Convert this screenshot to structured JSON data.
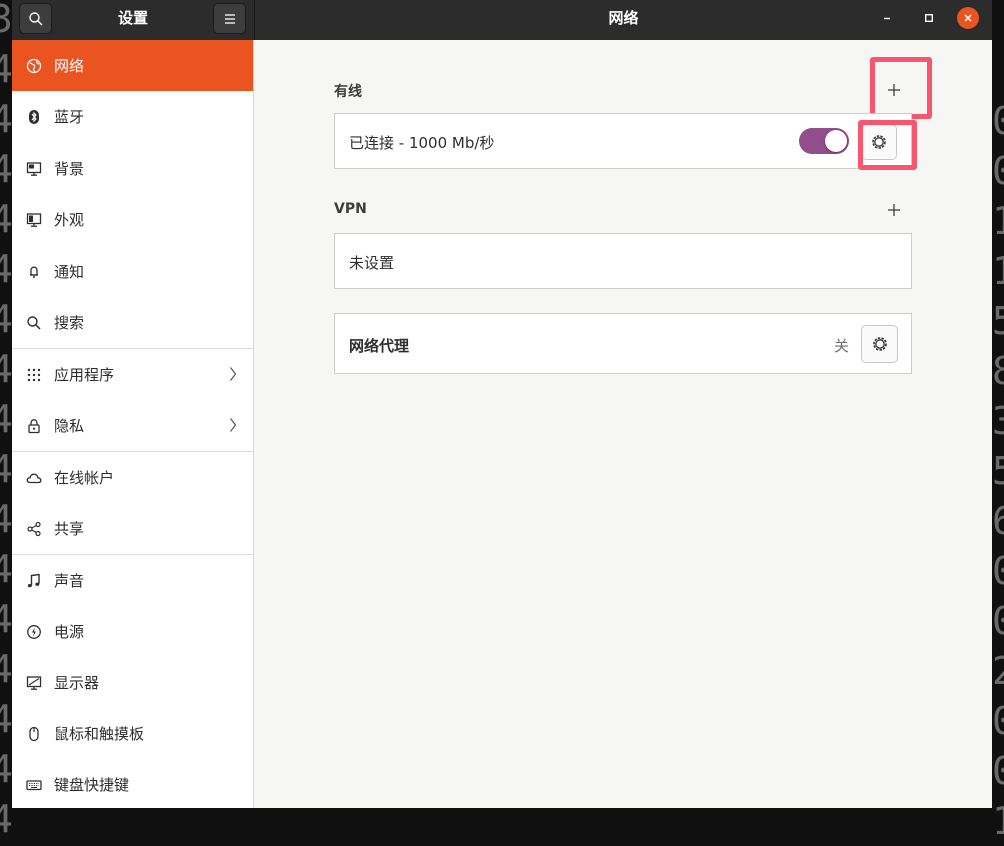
{
  "colors": {
    "accent": "#e95420",
    "toggle_on": "#924d8b",
    "highlight": "#f7566e"
  },
  "header": {
    "sidebar_title": "设置",
    "page_title": "网络"
  },
  "sidebar": {
    "items": [
      {
        "label": "网络",
        "icon": "network-icon",
        "active": true
      },
      {
        "label": "蓝牙",
        "icon": "bluetooth-icon"
      },
      {
        "label": "背景",
        "icon": "background-icon"
      },
      {
        "label": "外观",
        "icon": "appearance-icon"
      },
      {
        "label": "通知",
        "icon": "bell-icon"
      },
      {
        "label": "搜索",
        "icon": "search-icon"
      },
      {
        "label": "应用程序",
        "icon": "apps-grid-icon",
        "has_submenu": true
      },
      {
        "label": "隐私",
        "icon": "lock-icon",
        "has_submenu": true
      },
      {
        "label": "在线帐户",
        "icon": "cloud-icon"
      },
      {
        "label": "共享",
        "icon": "share-icon"
      },
      {
        "label": "声音",
        "icon": "music-note-icon"
      },
      {
        "label": "电源",
        "icon": "power-icon"
      },
      {
        "label": "显示器",
        "icon": "display-icon"
      },
      {
        "label": "鼠标和触摸板",
        "icon": "mouse-icon"
      },
      {
        "label": "键盘快捷键",
        "icon": "keyboard-icon"
      }
    ]
  },
  "wired": {
    "title": "有线",
    "add_label": "+",
    "connection_label": "已连接 - 1000 Mb/秒",
    "toggle_on": true
  },
  "vpn": {
    "title": "VPN",
    "add_label": "+",
    "empty_label": "未设置"
  },
  "proxy": {
    "label": "网络代理",
    "status": "关"
  },
  "background": {
    "left_glyphs": [
      "3",
      "4",
      "4",
      "4",
      "4",
      "4",
      "4",
      "4",
      "4",
      "4",
      "4",
      "4",
      "4",
      "4",
      "4",
      "4",
      "4"
    ],
    "right_glyphs": [
      "0",
      "0",
      "1",
      "1",
      "5",
      "8",
      "3",
      "5",
      "6",
      "0",
      "0",
      "2",
      "0",
      "0",
      "1"
    ]
  }
}
